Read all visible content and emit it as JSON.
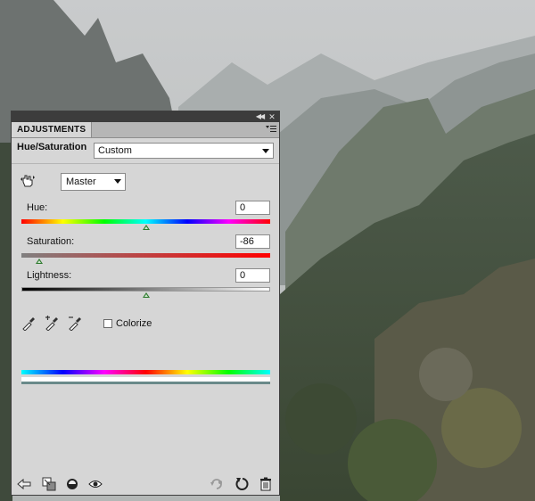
{
  "panel": {
    "tab_label": "ADJUSTMENTS",
    "adjustment_title": "Hue/Saturation",
    "preset": "Custom",
    "channel": "Master",
    "hue": {
      "label": "Hue:",
      "value": "0",
      "position": 0.5
    },
    "saturation": {
      "label": "Saturation:",
      "value": "-86",
      "position": 0.07
    },
    "lightness": {
      "label": "Lightness:",
      "value": "0",
      "position": 0.5
    },
    "colorize_label": "Colorize",
    "colorize_checked": false,
    "accent_thumb_color": "#2f7a2f"
  },
  "icons": {
    "titlebar": [
      "collapse-icon",
      "close-icon"
    ],
    "panel_menu": "panel-menu-icon",
    "tool": "on-image-adjust-icon",
    "droppers": [
      "eyedropper-icon",
      "eyedropper-plus-icon",
      "eyedropper-minus-icon"
    ],
    "bottom_left": [
      "return-arrow-icon",
      "clip-to-layer-icon",
      "layer-visibility-toggle-icon",
      "eye-icon"
    ],
    "bottom_right": [
      "previous-state-icon",
      "reset-icon",
      "trash-icon"
    ]
  }
}
